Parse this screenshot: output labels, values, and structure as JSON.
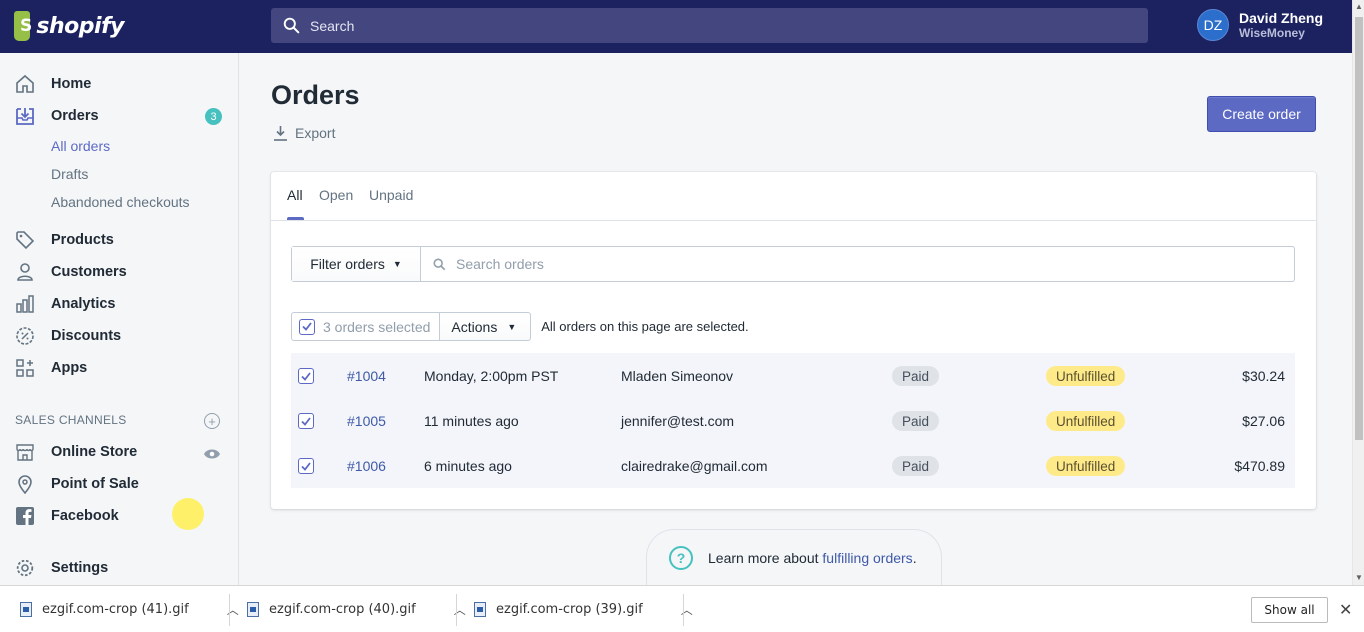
{
  "topbar": {
    "brand": "shopify",
    "search_placeholder": "Search",
    "user_initials": "DZ",
    "user_name": "David Zheng",
    "store_name": "WiseMoney"
  },
  "sidebar": {
    "items": [
      {
        "label": "Home",
        "icon": "home-icon"
      },
      {
        "label": "Orders",
        "icon": "orders-icon",
        "badge": "3"
      },
      {
        "label": "Products",
        "icon": "tag-icon"
      },
      {
        "label": "Customers",
        "icon": "person-icon"
      },
      {
        "label": "Analytics",
        "icon": "bar-chart-icon"
      },
      {
        "label": "Discounts",
        "icon": "discount-icon"
      },
      {
        "label": "Apps",
        "icon": "apps-icon"
      }
    ],
    "order_subitems": [
      "All orders",
      "Drafts",
      "Abandoned checkouts"
    ],
    "sales_channels_title": "SALES CHANNELS",
    "channels": [
      {
        "label": "Online Store",
        "icon": "store-icon"
      },
      {
        "label": "Point of Sale",
        "icon": "location-pin-icon"
      },
      {
        "label": "Facebook",
        "icon": "facebook-icon"
      }
    ],
    "settings_label": "Settings"
  },
  "page": {
    "title": "Orders",
    "export_label": "Export",
    "create_button": "Create order"
  },
  "tabs": [
    "All",
    "Open",
    "Unpaid"
  ],
  "filter": {
    "button_label": "Filter orders",
    "search_placeholder": "Search orders"
  },
  "bulk": {
    "selected_label": "3 orders selected",
    "actions_label": "Actions",
    "note": "All orders on this page are selected."
  },
  "orders": [
    {
      "number": "#1004",
      "date": "Monday, 2:00pm PST",
      "customer": "Mladen Simeonov",
      "payment": "Paid",
      "fulfillment": "Unfulfilled",
      "total": "$30.24"
    },
    {
      "number": "#1005",
      "date": "11 minutes ago",
      "customer": "jennifer@test.com",
      "payment": "Paid",
      "fulfillment": "Unfulfilled",
      "total": "$27.06"
    },
    {
      "number": "#1006",
      "date": "6 minutes ago",
      "customer": "clairedrake@gmail.com",
      "payment": "Paid",
      "fulfillment": "Unfulfilled",
      "total": "$470.89"
    }
  ],
  "learn": {
    "text": "Learn more about",
    "link": "fulfilling orders",
    "period": "."
  },
  "downloads": {
    "files": [
      "ezgif.com-crop (41).gif",
      "ezgif.com-crop (40).gif",
      "ezgif.com-crop (39).gif"
    ],
    "show_all": "Show all"
  },
  "colors": {
    "topbar": "#1c2260",
    "accent": "#5c6ac4",
    "badge": "#47c1bf",
    "unfulfilled": "#ffea8a"
  }
}
